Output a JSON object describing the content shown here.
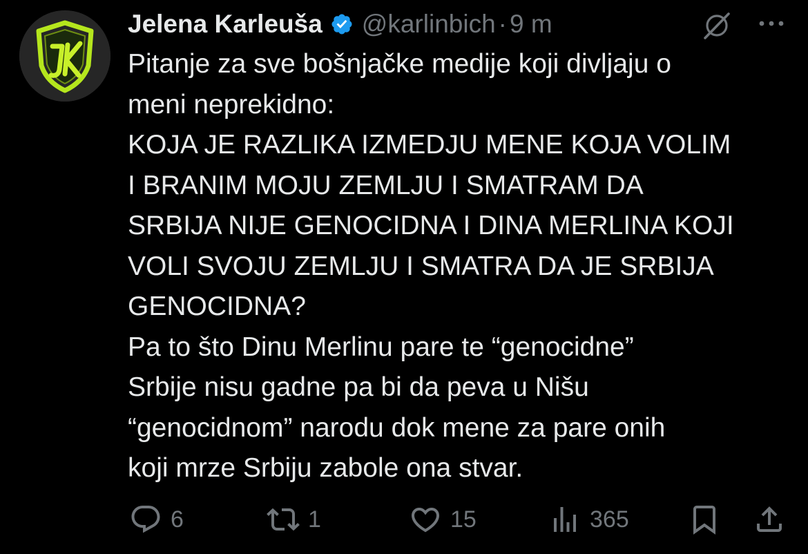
{
  "author": {
    "display_name": "Jelena Karleuša",
    "handle": "@karlinbich",
    "separator": "·",
    "time": "9 m",
    "verified": true,
    "avatar_icon": "jk-shield-logo-icon"
  },
  "tweet": {
    "lines": [
      "Pitanje za sve bošnjačke medije koji divljaju o",
      "meni neprekidno:",
      "KOJA JE RAZLIKA IZMEDJU MENE KOJA VOLIM",
      "I BRANIM MOJU ZEMLJU I SMATRAM DA",
      "SRBIJA NIJE GENOCIDNA I DINA MERLINA KOJI",
      "VOLI SVOJU ZEMLJU I SMATRA DA JE SRBIJA",
      "GENOCIDNA?",
      "Pa to što Dinu Merlinu pare te “genocidne”",
      "Srbije nisu gadne pa bi da peva u Nišu",
      "“genocidnom” narodu dok mene za pare onih",
      "koji mrze Srbiju zabole ona stvar."
    ]
  },
  "actions": {
    "replies": "6",
    "reposts": "1",
    "likes": "15",
    "views": "365"
  },
  "colors": {
    "background": "#000000",
    "text": "#e7e9ea",
    "secondary": "#71767b",
    "verified": "#1d9bf0",
    "avatar_accent": "#b5e61d"
  }
}
